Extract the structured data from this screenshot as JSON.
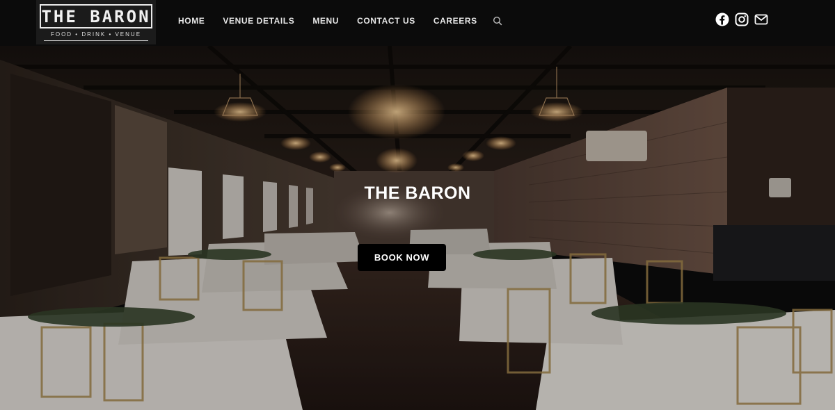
{
  "brand": {
    "name": "THE BARON",
    "tagline": "FOOD  •  DRINK  •  VENUE"
  },
  "nav": {
    "items": [
      {
        "label": "HOME"
      },
      {
        "label": "VENUE DETAILS"
      },
      {
        "label": "MENU"
      },
      {
        "label": "CONTACT US"
      },
      {
        "label": "CAREERS"
      }
    ],
    "search_icon": "search-icon"
  },
  "social": {
    "icons": [
      "facebook-icon",
      "instagram-icon",
      "email-icon"
    ]
  },
  "hero": {
    "title": "THE BARON",
    "cta_label": "BOOK NOW"
  },
  "colors": {
    "header_bg": "#0b0b0b",
    "button_bg": "#000000",
    "text": "#ffffff"
  }
}
